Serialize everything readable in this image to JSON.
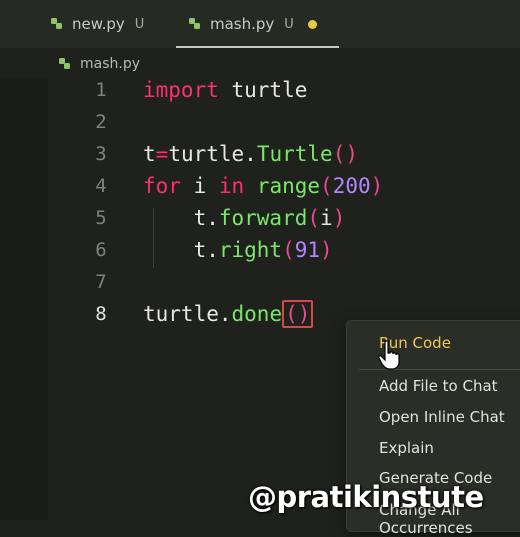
{
  "tabs": [
    {
      "label": "new.py",
      "status": "U"
    },
    {
      "label": "mash.py",
      "status": "U",
      "modified": true
    }
  ],
  "breadcrumb": "mash.py",
  "code_lines": [
    {
      "number": "1",
      "text": "import turtle"
    },
    {
      "number": "2",
      "text": ""
    },
    {
      "number": "3",
      "text": "t=turtle.Turtle()"
    },
    {
      "number": "4",
      "text": "for i in range(200)"
    },
    {
      "number": "5",
      "text": "    t.forward(i)"
    },
    {
      "number": "6",
      "text": "    t.right(91)"
    },
    {
      "number": "7",
      "text": ""
    },
    {
      "number": "8",
      "text": "turtle.done()"
    }
  ],
  "context_menu": {
    "items": [
      {
        "label": "Run Code",
        "highlighted": true
      },
      {
        "label": "Add File to Chat"
      },
      {
        "label": "Open Inline Chat"
      },
      {
        "label": "Explain"
      },
      {
        "label": "Generate Code"
      },
      {
        "label": "Change All Occurrences"
      }
    ]
  },
  "watermark": "@pratikinstute",
  "colors": {
    "keyword": "#ff2d74",
    "function": "#7ce66a",
    "number": "#b784ff",
    "modified_dot": "#e8c94a",
    "menu_highlight": "#eec85a"
  }
}
